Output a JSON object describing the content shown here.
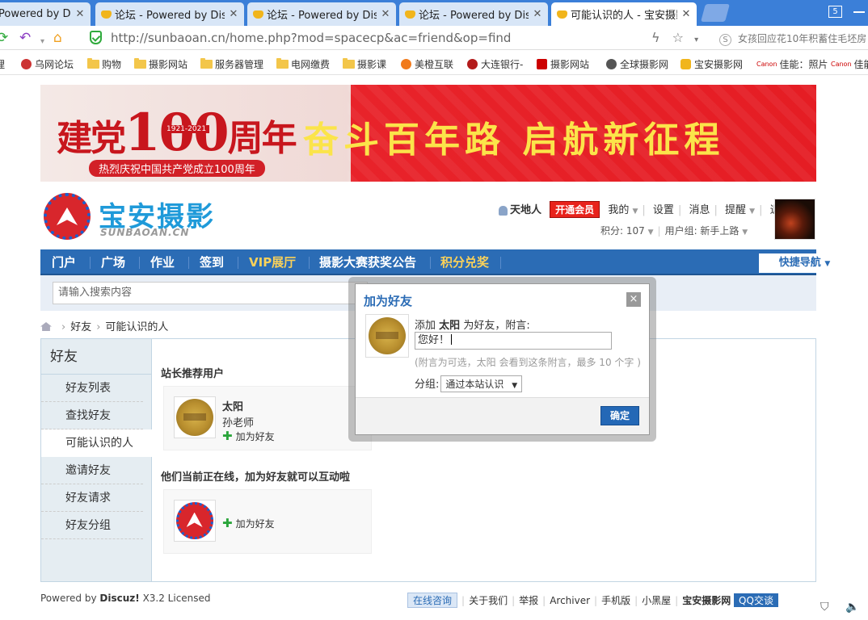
{
  "browser": {
    "tabs": [
      {
        "label": "Powered by Dis"
      },
      {
        "label": "论坛 - Powered by Dis"
      },
      {
        "label": "论坛 - Powered by Dis"
      },
      {
        "label": "论坛 - Powered by Dis"
      },
      {
        "label": "可能认识的人 - 宝安摄影"
      }
    ],
    "window_count": "5",
    "url": "http://sunbaoan.cn/home.php?mod=spacecp&ac=friend&op=find",
    "search_hint": "女孩回应花10年积蓄住毛坯房",
    "bookmarks": [
      "乌网论坛",
      "购物",
      "摄影网站",
      "服务器管理",
      "电网缴费",
      "摄影课",
      "美橙互联",
      "大连银行-",
      "摄影网站",
      "全球摄影网",
      "宝安摄影网",
      "佳能：照片",
      "佳能"
    ]
  },
  "banner": {
    "left_text_1": "建党",
    "left_number": "100",
    "left_text_2": "周年",
    "years": "1921-2021",
    "sub": "热烈庆祝中国共产党成立100周年",
    "slogan": "奋斗百年路 启航新征程"
  },
  "site": {
    "logo_title": "宝安摄影",
    "logo_sub": "SUNBAOAN.CN"
  },
  "user": {
    "name": "天地人",
    "vip_button": "开通会员",
    "menu": [
      "我的",
      "设置",
      "消息",
      "提醒",
      "退出"
    ],
    "points_label": "积分: 107",
    "group_label": "用户组: 新手上路"
  },
  "nav": {
    "items": [
      "门户",
      "广场",
      "作业",
      "签到",
      "VIP展厅",
      "摄影大赛获奖公告",
      "积分兑奖"
    ],
    "quick_nav": "快捷导航"
  },
  "search": {
    "placeholder": "请输入搜索内容"
  },
  "breadcrumb": {
    "items": [
      "好友",
      "可能认识的人"
    ]
  },
  "sidebar": {
    "title": "好友",
    "items": [
      "好友列表",
      "查找好友",
      "可能认识的人",
      "邀请好友",
      "好友请求",
      "好友分组"
    ],
    "active_index": 2
  },
  "main": {
    "section1_title": "站长推荐用户",
    "card1": {
      "name": "太阳",
      "note": "孙老师",
      "action": "加为好友"
    },
    "section2_title": "他们当前正在线，加为好友就可以互动啦",
    "card2": {
      "action": "加为好友"
    }
  },
  "footer": {
    "powered": "Powered by",
    "discuz": "Discuz!",
    "version": "X3.2 Licensed",
    "links": [
      "在线咨询",
      "关于我们",
      "举报",
      "Archiver",
      "手机版",
      "小黑屋",
      "宝安摄影网",
      "QQ交谈"
    ]
  },
  "dialog": {
    "title": "加为好友",
    "close": "×",
    "line_prefix": "添加",
    "line_name": "太阳",
    "line_suffix": "为好友，附言:",
    "message_value": "您好！",
    "hint": "(附言为可选，太阳 会看到这条附言，最多 10 个字 )",
    "group_label": "分组:",
    "group_value": "通过本站认识",
    "ok_button": "确定"
  }
}
